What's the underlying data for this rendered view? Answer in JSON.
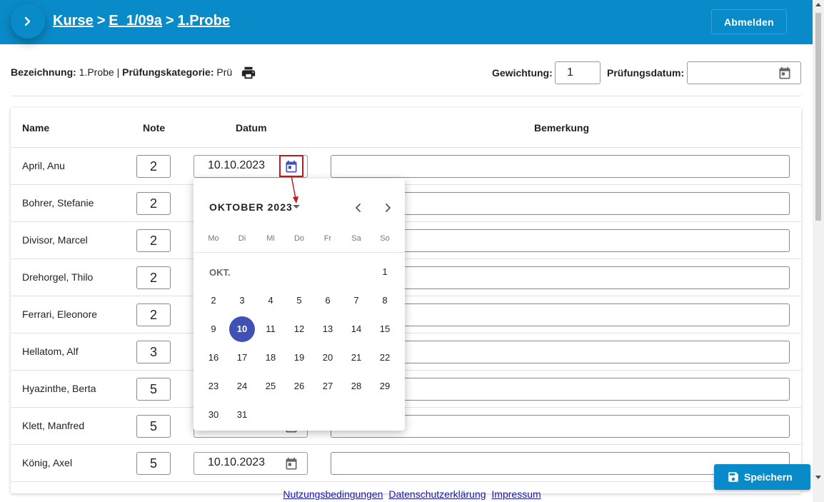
{
  "header": {
    "breadcrumb": [
      "Kurse",
      "E_1/09a",
      "1.Probe"
    ],
    "separator": ">",
    "logout_label": "Abmelden",
    "toggle_icon": "chevron-right-icon"
  },
  "info": {
    "bezeichnung_label": "Bezeichnung:",
    "bezeichnung_value": "1.Probe",
    "divider": "|",
    "kategorie_label": "Prüfungskategorie:",
    "kategorie_value": "Prü",
    "gewichtung_label": "Gewichtung:",
    "gewichtung_value": "1",
    "pruefungsdatum_label": "Prüfungsdatum:",
    "pruefungsdatum_value": ""
  },
  "table": {
    "headers": [
      "Name",
      "Note",
      "Datum",
      "Bemerkung"
    ],
    "rows": [
      {
        "name": "April, Anu",
        "note": "2",
        "datum": "10.10.2023",
        "bemerkung": ""
      },
      {
        "name": "Bohrer, Stefanie",
        "note": "2",
        "datum": "",
        "bemerkung": ""
      },
      {
        "name": "Divisor, Marcel",
        "note": "2",
        "datum": "",
        "bemerkung": ""
      },
      {
        "name": "Drehorgel, Thilo",
        "note": "2",
        "datum": "",
        "bemerkung": ""
      },
      {
        "name": "Ferrari, Eleonore",
        "note": "2",
        "datum": "",
        "bemerkung": ""
      },
      {
        "name": "Hellatom, Alf",
        "note": "3",
        "datum": "",
        "bemerkung": ""
      },
      {
        "name": "Hyazinthe, Berta",
        "note": "5",
        "datum": "",
        "bemerkung": ""
      },
      {
        "name": "Klett, Manfred",
        "note": "5",
        "datum": "",
        "bemerkung": ""
      },
      {
        "name": "König, Axel",
        "note": "5",
        "datum": "10.10.2023",
        "bemerkung": ""
      }
    ]
  },
  "datepicker": {
    "month_label": "OKTOBER 2023",
    "weekdays": [
      "Mo",
      "Di",
      "Mi",
      "Do",
      "Fr",
      "Sa",
      "So"
    ],
    "month_short": "OKT.",
    "first_weekday_index": 6,
    "days_in_month": 31,
    "selected_day": 10,
    "selected_color": "#3f51b5"
  },
  "footer": {
    "links": [
      "Nutzungsbedingungen",
      "Datenschutzerklärung",
      "Impressum"
    ],
    "save_label": "Speichern"
  },
  "colors": {
    "brand": "#0a8bc9",
    "annotation": "#c8181e"
  }
}
